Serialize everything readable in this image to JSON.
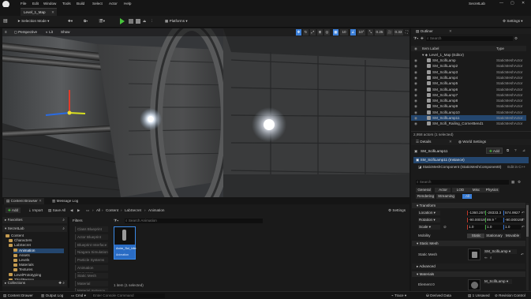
{
  "window": {
    "title": "SecretLab"
  },
  "menu": [
    "File",
    "Edit",
    "Window",
    "Tools",
    "Build",
    "Select",
    "Actor",
    "Help"
  ],
  "level_tab": "Level_1_Map",
  "toolbar": {
    "selection_mode": "Selection Mode",
    "platforms": "Platforms",
    "settings": "Settings"
  },
  "viewport": {
    "perspective": "Perspective",
    "lit": "Lit",
    "show": "Show",
    "grid_snap": "10",
    "rot_snap": "10°",
    "scale_snap": "0.25",
    "cam_speed": "0.33"
  },
  "outliner": {
    "title": "Outliner",
    "search_placeholder": "Search",
    "col_label": "Item Label",
    "col_type": "Type",
    "root": "Level_1_Map (Editor)",
    "rows": [
      {
        "name": "SM_ScifiLamp",
        "type": "StaticMeshActor"
      },
      {
        "name": "SM_ScifiLamp2",
        "type": "StaticMeshActor"
      },
      {
        "name": "SM_ScifiLamp3",
        "type": "StaticMeshActor"
      },
      {
        "name": "SM_ScifiLamp4",
        "type": "StaticMeshActor"
      },
      {
        "name": "SM_ScifiLamp5",
        "type": "StaticMeshActor"
      },
      {
        "name": "SM_ScifiLamp6",
        "type": "StaticMeshActor"
      },
      {
        "name": "SM_ScifiLamp7",
        "type": "StaticMeshActor"
      },
      {
        "name": "SM_ScifiLamp8",
        "type": "StaticMeshActor"
      },
      {
        "name": "SM_ScifiLamp9",
        "type": "StaticMeshActor"
      },
      {
        "name": "SM_ScifiLamp10",
        "type": "StaticMeshActor"
      },
      {
        "name": "SM_ScifiLamp11",
        "type": "StaticMeshActor"
      },
      {
        "name": "SM_Scifi_Railing_CornerBend1",
        "type": "StaticMeshActor"
      }
    ],
    "status": "2,958 actors (1 selected)"
  },
  "details": {
    "tab": "Details",
    "tab2": "World Settings",
    "actor_name": "SM_ScifiLamp11",
    "add": "Add",
    "instance": "SM_ScifiLamp11 (Instance)",
    "component": "StaticMeshComponent (StaticMeshComponent0)",
    "edit_cpp": "Edit in C++",
    "search_placeholder": "Search",
    "filter_tabs": [
      "General",
      "Actor",
      "LOD",
      "Misc",
      "Physics"
    ],
    "filter_tabs2": [
      "Rendering",
      "Streaming",
      "All"
    ],
    "transform_header": "Transform",
    "location_label": "Location",
    "location": [
      "-1360.257",
      "-28333.3",
      "574.9927"
    ],
    "rotation_label": "Rotation",
    "rotation": [
      "-90.000191",
      "89.9 °",
      "-90.000192"
    ],
    "scale_label": "Scale",
    "scale": [
      "1.0",
      "1.0",
      "1.0"
    ],
    "mobility_label": "Mobility",
    "mobility": [
      "Static",
      "Stationary",
      "Movable"
    ],
    "static_mesh_header": "Static Mesh",
    "static_mesh_label": "Static Mesh",
    "static_mesh_value": "SM_ScifiLamp",
    "advanced": "Advanced",
    "materials_header": "Materials",
    "element_label": "Element 0",
    "element_value": "M_ScifiLamp"
  },
  "content_browser": {
    "tab": "Content Browser",
    "tab2": "Message Log",
    "add": "Add",
    "import": "Import",
    "save_all": "Save All",
    "settings": "Settings",
    "path": [
      "All",
      "Content",
      "LabSecret",
      "Animation"
    ],
    "favorites": "Favorites",
    "project": "SecretLab",
    "tree": [
      "Content",
      "Characters",
      "LabSecret",
      "Animation",
      "Assets",
      "Levels",
      "Materials",
      "Textures",
      "LevelPrototyping",
      "ThirdPerson"
    ],
    "collections": "Collections",
    "filters": "Filters",
    "filter_list": [
      "Class Blueprint",
      "Actor Blueprint",
      "Blueprint Interface",
      "Niagara Simulation",
      "Particle Systems",
      "Animation Sequence",
      "Static Mesh",
      "Material",
      "Material Instance"
    ],
    "search_placeholder": "Search Animation",
    "asset_name": "Anim_Sci_Idle",
    "asset_type": "Animation",
    "count": "1 item (1 selected)"
  },
  "bottom": {
    "content_drawer": "Content Drawer",
    "output_log": "Output Log",
    "cmd": "Cmd",
    "cmd_placeholder": "Enter Console Command",
    "trace": "Trace",
    "derived_data": "Derived Data",
    "unsaved": "1 Unsaved",
    "revision": "Revision Control"
  }
}
